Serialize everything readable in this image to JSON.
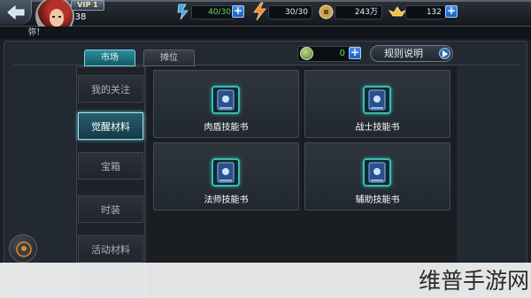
{
  "header": {
    "vip_label": "VIP 1",
    "level": "38",
    "stamina": {
      "icon": "stamina-icon",
      "value": "40/30"
    },
    "energy": {
      "icon": "lightning-icon",
      "value": "30/30"
    },
    "coins": {
      "icon": "coin-icon",
      "value": "243万"
    },
    "gold": {
      "icon": "gold-ingot-icon",
      "value": "132"
    }
  },
  "message_strip": {
    "text": "弥！"
  },
  "top_tabs": [
    {
      "label": "市场",
      "active": true
    },
    {
      "label": "摊位",
      "active": false
    }
  ],
  "currency": {
    "icon": "jade-coin-icon",
    "value": "0"
  },
  "rules_button": {
    "label": "规则说明"
  },
  "side_menu": [
    {
      "label": "我的关注",
      "active": false
    },
    {
      "label": "觉醒材料",
      "active": true
    },
    {
      "label": "宝箱",
      "active": false
    },
    {
      "label": "时装",
      "active": false
    },
    {
      "label": "活动材料",
      "active": false
    }
  ],
  "items": [
    {
      "name": "肉盾技能书",
      "icon": "skill-book-icon"
    },
    {
      "name": "战士技能书",
      "icon": "skill-book-icon"
    },
    {
      "name": "法师技能书",
      "icon": "skill-book-icon"
    },
    {
      "name": "辅助技能书",
      "icon": "skill-book-icon"
    }
  ],
  "watermark": {
    "text": "维普手游网"
  },
  "colors": {
    "accent_teal": "#2a8d9d",
    "plus_blue": "#3e8ef2",
    "value_green": "#65d85a",
    "book_frame": "#3fb9b0"
  }
}
